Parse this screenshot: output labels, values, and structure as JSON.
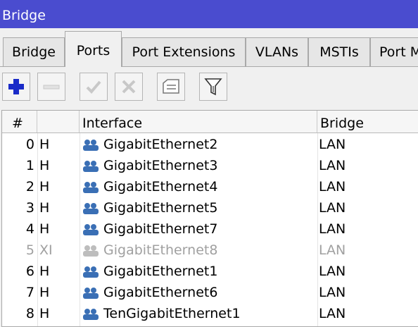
{
  "window": {
    "title": "Bridge"
  },
  "tabs": [
    {
      "label": "Bridge"
    },
    {
      "label": "Ports"
    },
    {
      "label": "Port Extensions"
    },
    {
      "label": "VLANs"
    },
    {
      "label": "MSTIs"
    },
    {
      "label": "Port M"
    }
  ],
  "active_tab": "Ports",
  "toolbar": {
    "buttons": [
      "add-icon",
      "remove-icon",
      "enable-icon",
      "disable-icon",
      "comment-icon",
      "filter-icon"
    ]
  },
  "table": {
    "columns": [
      "#",
      "",
      "Interface",
      "Bridge"
    ],
    "rows": [
      {
        "num": "0",
        "flag": "H",
        "interface": "GigabitEthernet2",
        "bridge": "LAN",
        "disabled": false
      },
      {
        "num": "1",
        "flag": "H",
        "interface": "GigabitEthernet3",
        "bridge": "LAN",
        "disabled": false
      },
      {
        "num": "2",
        "flag": "H",
        "interface": "GigabitEthernet4",
        "bridge": "LAN",
        "disabled": false
      },
      {
        "num": "3",
        "flag": "H",
        "interface": "GigabitEthernet5",
        "bridge": "LAN",
        "disabled": false
      },
      {
        "num": "4",
        "flag": "H",
        "interface": "GigabitEthernet7",
        "bridge": "LAN",
        "disabled": false
      },
      {
        "num": "5",
        "flag": "XI",
        "interface": "GigabitEthernet8",
        "bridge": "LAN",
        "disabled": true
      },
      {
        "num": "6",
        "flag": "H",
        "interface": "GigabitEthernet1",
        "bridge": "LAN",
        "disabled": false
      },
      {
        "num": "7",
        "flag": "H",
        "interface": "GigabitEthernet6",
        "bridge": "LAN",
        "disabled": false
      },
      {
        "num": "8",
        "flag": "H",
        "interface": "TenGigabitEthernet1",
        "bridge": "LAN",
        "disabled": false
      }
    ]
  },
  "colors": {
    "titlebar": "#4a4ccf",
    "icon_blue": "#3a6fb5",
    "disabled_text": "#a0a0a0"
  }
}
